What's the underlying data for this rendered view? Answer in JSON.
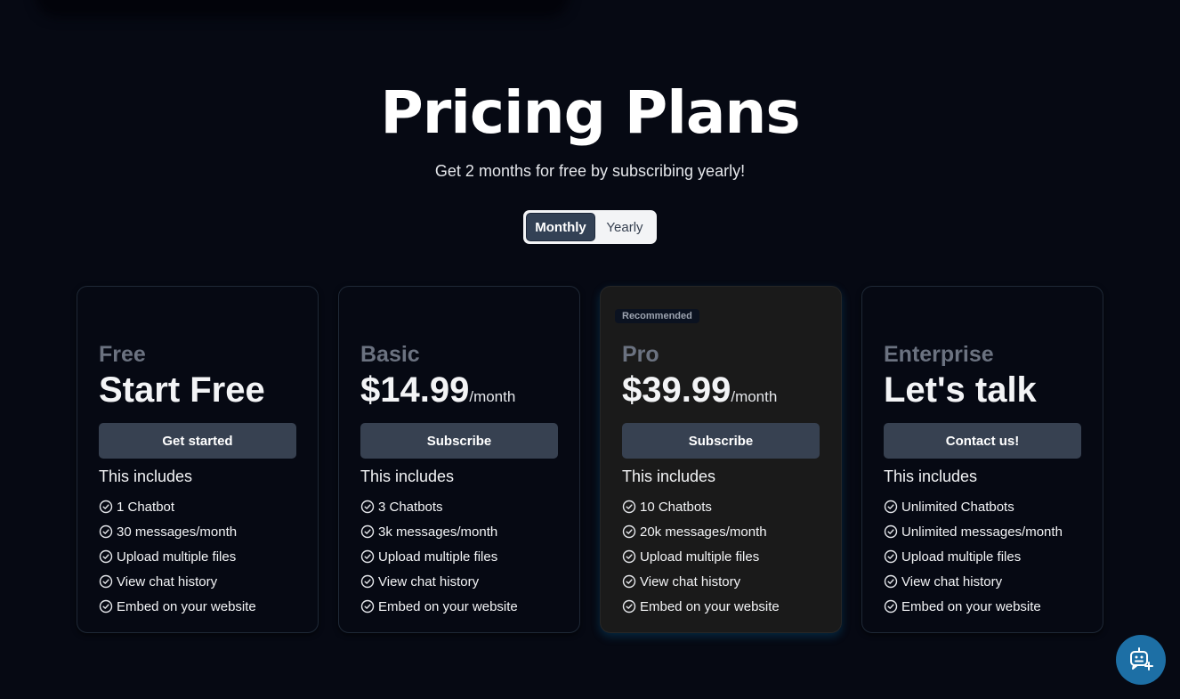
{
  "header": {
    "title": "Pricing Plans",
    "subtitle": "Get 2 months for free by subscribing yearly!"
  },
  "billing_toggle": {
    "selected": "Monthly",
    "options": [
      "Monthly",
      "Yearly"
    ]
  },
  "includes_label": "This includes",
  "plans": [
    {
      "name": "Free",
      "price": "Start Free",
      "unit": "",
      "cta": "Get started",
      "features": [
        "1 Chatbot",
        "30 messages/month",
        "Upload multiple files",
        "View chat history",
        "Embed on your website"
      ]
    },
    {
      "name": "Basic",
      "price": "$14.99",
      "unit": "/month",
      "cta": "Subscribe",
      "features": [
        "3 Chatbots",
        "3k messages/month",
        "Upload multiple files",
        "View chat history",
        "Embed on your website"
      ]
    },
    {
      "name": "Pro",
      "badge": "Recommended",
      "price": "$39.99",
      "unit": "/month",
      "cta": "Subscribe",
      "features": [
        "10 Chatbots",
        "20k messages/month",
        "Upload multiple files",
        "View chat history",
        "Embed on your website"
      ]
    },
    {
      "name": "Enterprise",
      "price": "Let's talk",
      "unit": "",
      "cta": "Contact us!",
      "features": [
        "Unlimited Chatbots",
        "Unlimited messages/month",
        "Upload multiple files",
        "View chat history",
        "Embed on your website"
      ]
    }
  ],
  "chat_widget": {
    "icon": "chatbot-icon"
  },
  "colors": {
    "background": "#060913",
    "card_highlight": "#1a1a1a",
    "button": "#374151",
    "toggle_active": "#334155",
    "chat_widget": "#1d6fa5"
  }
}
